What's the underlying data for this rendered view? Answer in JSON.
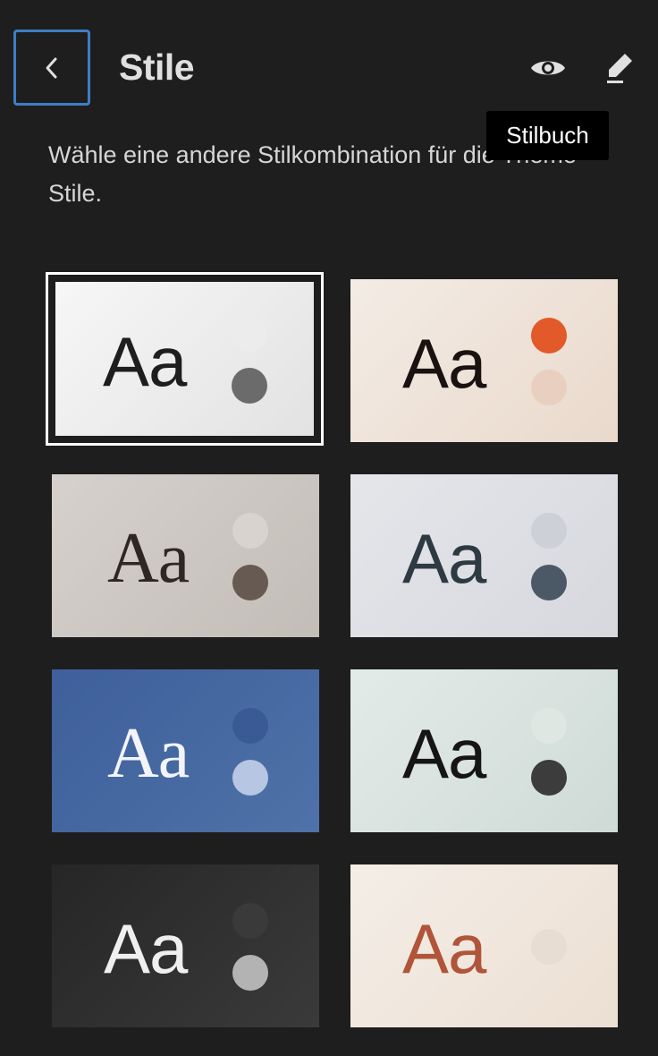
{
  "header": {
    "title": "Stile",
    "back_icon": "chevron-left-icon",
    "preview_icon": "eye-icon",
    "edit_icon": "pencil-icon"
  },
  "description": "Wähle eine andere Stilkombination für die Theme-Stile.",
  "tooltip": "Stilbuch",
  "variations": [
    {
      "label": "Aa",
      "font": "sans",
      "selected": true,
      "bg": "linear-gradient(135deg,#f7f7f7,#e2e2e2)",
      "text_color": "#1e1e1e",
      "dot_top": "#ececec",
      "dot_bottom": "#6b6b6b"
    },
    {
      "label": "Aa",
      "font": "sans",
      "selected": false,
      "bg": "linear-gradient(135deg,#f3ece5,#ead9cc)",
      "text_color": "#1a1210",
      "dot_top": "#e2592a",
      "dot_bottom": "#e8cfbf"
    },
    {
      "label": "Aa",
      "font": "serif",
      "selected": false,
      "bg": "linear-gradient(135deg,#d6d1cc,#c3bdb8)",
      "text_color": "#2e2722",
      "dot_top": "#d8d3ce",
      "dot_bottom": "#675a52"
    },
    {
      "label": "Aa",
      "font": "sans",
      "selected": false,
      "bg": "linear-gradient(135deg,#e5e6ea,#d6d8de)",
      "text_color": "#2d3a42",
      "dot_top": "#cdd0d6",
      "dot_bottom": "#4a5965"
    },
    {
      "label": "Aa",
      "font": "serif",
      "selected": false,
      "bg": "linear-gradient(135deg,#3e5f9b,#4f72a8)",
      "text_color": "#f2f4fa",
      "dot_top": "#3a5a95",
      "dot_bottom": "#b6c6e3"
    },
    {
      "label": "Aa",
      "font": "sans",
      "selected": false,
      "bg": "linear-gradient(135deg,#e3ebe8,#cfdad6)",
      "text_color": "#151515",
      "dot_top": "#dfe7e3",
      "dot_bottom": "#3c3c3c"
    },
    {
      "label": "Aa",
      "font": "sans",
      "selected": false,
      "bg": "linear-gradient(135deg,#262626,#3a3a3a)",
      "text_color": "#efefef",
      "dot_top": "#3a3a3a",
      "dot_bottom": "#b3b3b3"
    },
    {
      "label": "Aa",
      "font": "sans",
      "selected": false,
      "bg": "linear-gradient(135deg,#f4eee7,#ecdfd3)",
      "text_color": "#b0543a",
      "dot_top": "#e8ddd2",
      "dot_bottom": null
    }
  ]
}
